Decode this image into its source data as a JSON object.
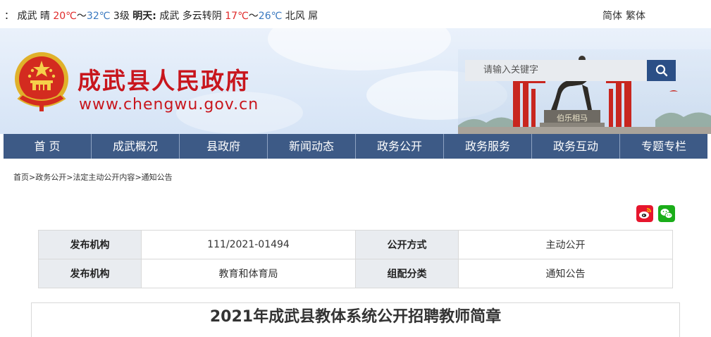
{
  "weather": {
    "prefix": "：",
    "city_today": "成武",
    "condition_today": "晴",
    "low_today": "20℃",
    "sep_today": "～",
    "high_today": "32℃",
    "wind_today": "3级",
    "tomorrow_label": "明天:",
    "city_tomorrow": "成武",
    "condition_tomorrow": "多云转阴",
    "low_tomorrow": "17℃",
    "sep_tomorrow": "～",
    "high_tomorrow": "26℃",
    "wind_tomorrow": "北风",
    "trailing": "屌"
  },
  "language": {
    "simplified": "简体",
    "traditional": "繁体"
  },
  "header": {
    "title": "成武县人民政府",
    "url": "www.chengwu.gov.cn",
    "statue_plaque": "伯乐相马"
  },
  "search": {
    "placeholder": "请输入关键字",
    "icon": "search-icon"
  },
  "nav": {
    "items": [
      {
        "label": "首 页"
      },
      {
        "label": "成武概况"
      },
      {
        "label": "县政府"
      },
      {
        "label": "新闻动态"
      },
      {
        "label": "政务公开"
      },
      {
        "label": "政务服务"
      },
      {
        "label": "政务互动"
      },
      {
        "label": "专题专栏"
      }
    ]
  },
  "breadcrumb": {
    "items": [
      "首页",
      "政务公开",
      "法定主动公开内容",
      "通知公告"
    ],
    "separator": ">"
  },
  "share": {
    "weibo_icon": "weibo-icon",
    "wechat_icon": "wechat-icon"
  },
  "meta": {
    "row1": {
      "label1": "发布机构",
      "value1": "111/2021-01494",
      "label2": "公开方式",
      "value2": "主动公开"
    },
    "row2": {
      "label1": "发布机构",
      "value1": "教育和体育局",
      "label2": "组配分类",
      "value2": "通知公告"
    }
  },
  "article": {
    "title": "2021年成武县教体系统公开招聘教师简章"
  },
  "colors": {
    "brand_red": "#c8161d",
    "nav_bg": "#3d5a86",
    "search_btn": "#2b4f86",
    "temp_low": "#e02a2a",
    "temp_high": "#3a79c0"
  }
}
